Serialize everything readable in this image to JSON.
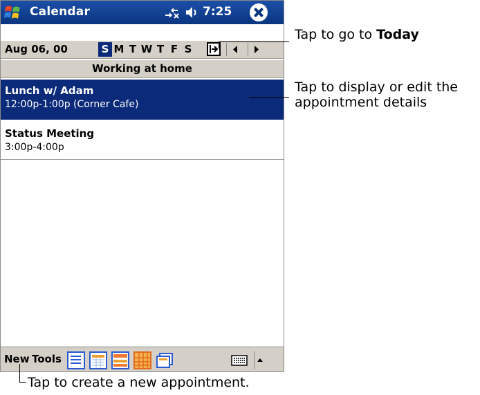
{
  "titlebar": {
    "app_title": "Calendar",
    "clock": "7:25"
  },
  "nav": {
    "date": "Aug 06, 00",
    "days": [
      "S",
      "M",
      "T",
      "W",
      "T",
      "F",
      "S"
    ],
    "selected_day_index": 0
  },
  "all_day_event": "Working at home",
  "appointments": [
    {
      "title": "Lunch w/ Adam",
      "details": "12:00p-1:00p (Corner Cafe)",
      "selected": true
    },
    {
      "title": "Status Meeting",
      "details": "3:00p-4:00p",
      "selected": false
    }
  ],
  "command_bar": {
    "new_label": "New",
    "tools_label": "Tools"
  },
  "callouts": {
    "today_prefix": "Tap to go to ",
    "today_bold": "Today",
    "details_line1": "Tap to display or edit the",
    "details_line2": "appointment details",
    "new_appt": "Tap to create a new appointment."
  },
  "colors": {
    "title_bar": "#0a3580",
    "selection": "#0b2a7a",
    "bar_gray": "#d4d0c8"
  }
}
